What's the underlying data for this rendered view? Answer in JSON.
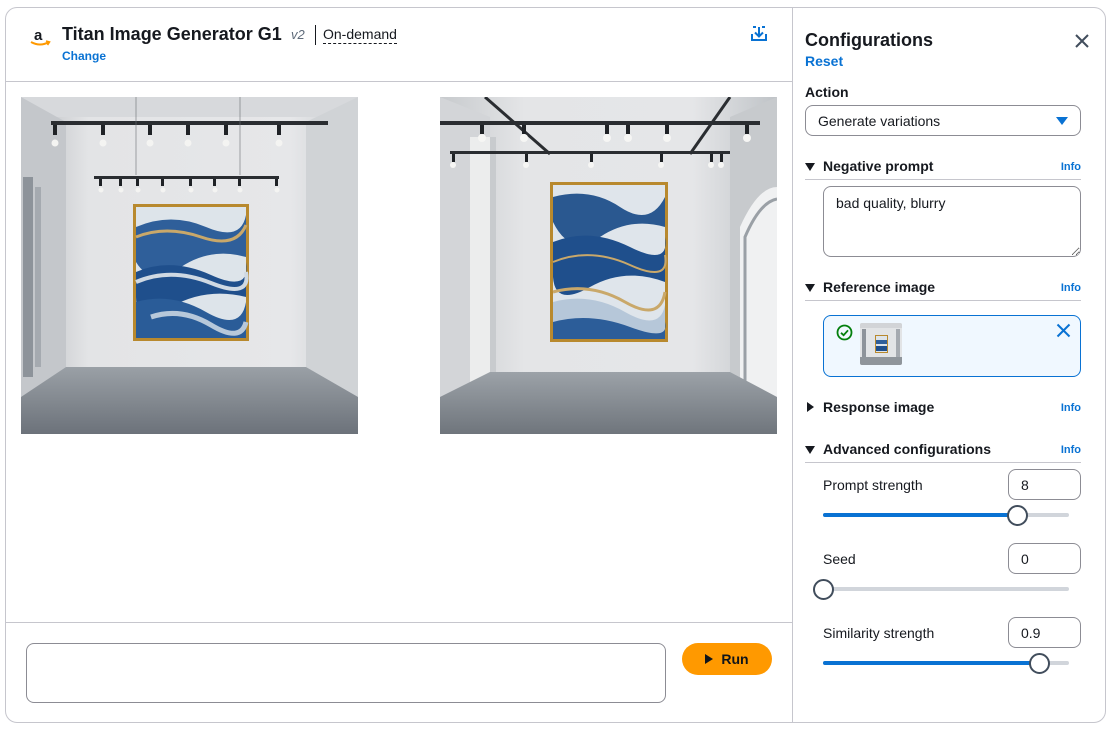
{
  "header": {
    "logo_icon": "amazon-logo",
    "model_title": "Titan Image Generator G1",
    "model_version": "v2",
    "mode": "On-demand",
    "change_label": "Change",
    "download_icon": "download-icon"
  },
  "prompt": {
    "value": "",
    "placeholder": "",
    "run_label": "Run"
  },
  "config": {
    "title": "Configurations",
    "reset_label": "Reset",
    "action_label": "Action",
    "action_value": "Generate variations",
    "negative_prompt": {
      "label": "Negative prompt",
      "info": "Info",
      "value": "bad quality, blurry"
    },
    "reference_image": {
      "label": "Reference image",
      "info": "Info"
    },
    "response_image": {
      "label": "Response image",
      "info": "Info"
    },
    "advanced": {
      "label": "Advanced configurations",
      "info": "Info",
      "prompt_strength": {
        "label": "Prompt strength",
        "value": "8",
        "fraction": 0.79
      },
      "seed": {
        "label": "Seed",
        "value": "0",
        "fraction": 0.0
      },
      "similarity_strength": {
        "label": "Similarity strength",
        "value": "0.9",
        "fraction": 0.88
      }
    }
  },
  "colors": {
    "accent": "#0972d3",
    "run_button": "#ff9900",
    "border": "#c6c6cd"
  }
}
